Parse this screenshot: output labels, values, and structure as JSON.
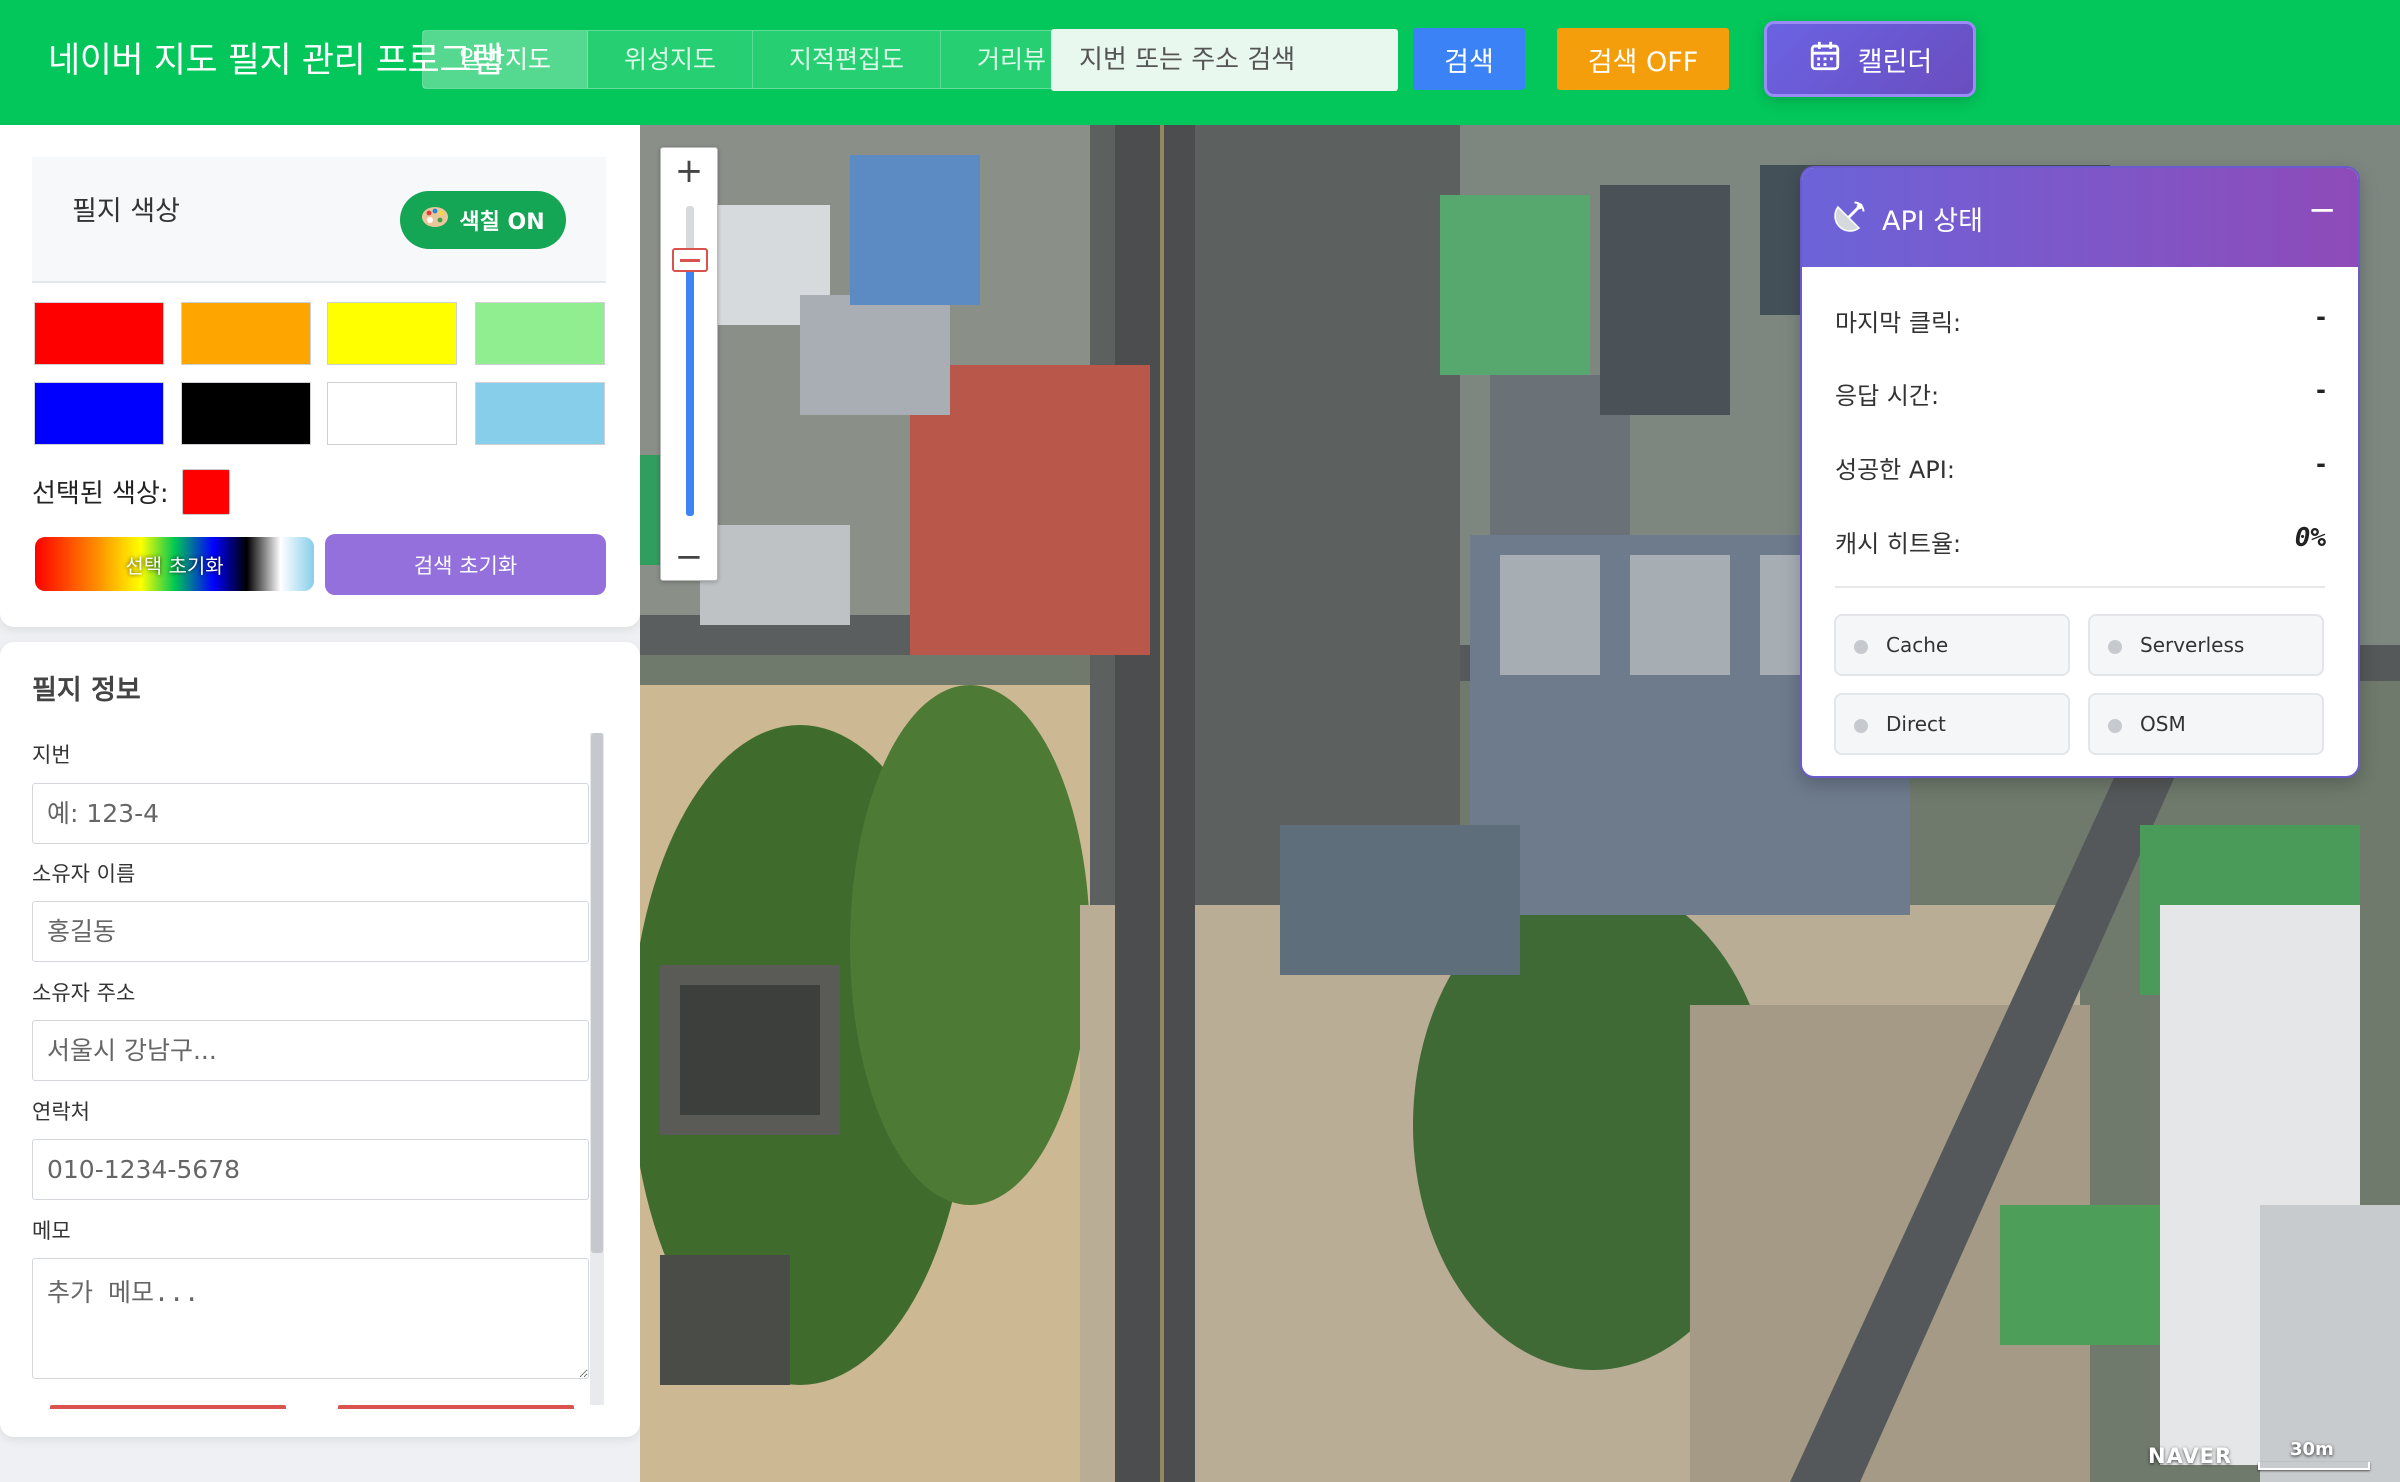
{
  "header": {
    "app_title": "네이버 지도 필지 관리 프로그램",
    "map_types": [
      "일반지도",
      "위성지도",
      "지적편집도",
      "거리뷰"
    ],
    "search_placeholder": "지번 또는 주소 검색",
    "search_label": "검색",
    "search_toggle_label": "검색 OFF",
    "calendar_label": "캘린더",
    "calendar_icon": "calendar-icon"
  },
  "color_panel": {
    "title": "필지 색상",
    "fill_toggle_label": "색칠 ON",
    "fill_toggle_icon": "palette-icon",
    "swatches": [
      "#ff0000",
      "#ffa500",
      "#ffff00",
      "#90ee90",
      "#0000ff",
      "#000000",
      "#ffffff",
      "#87ceeb"
    ],
    "selected_label": "선택된 색상:",
    "selected_color": "#ff0000",
    "reset_selection_label": "선택 초기화",
    "reset_search_label": "검색 초기화"
  },
  "parcel_info": {
    "title": "필지 정보",
    "fields": [
      {
        "label": "지번",
        "placeholder": "예: 123-4"
      },
      {
        "label": "소유자 이름",
        "placeholder": "홍길동"
      },
      {
        "label": "소유자 주소",
        "placeholder": "서울시 강남구..."
      },
      {
        "label": "연락처",
        "placeholder": "010-1234-5678"
      }
    ],
    "memo_label": "메모",
    "memo_placeholder": "추가 메모..."
  },
  "map": {
    "zoom_in": "+",
    "zoom_out": "−",
    "zoom_level_fraction": 0.82,
    "brand": "NAVER",
    "scale_label": "30m"
  },
  "api_status": {
    "title": "API 상태",
    "icon": "satellite-dish-icon",
    "minimize": "−",
    "rows": [
      {
        "label": "마지막 클릭:",
        "value": "-"
      },
      {
        "label": "응답 시간:",
        "value": "-"
      },
      {
        "label": "성공한 API:",
        "value": "-"
      },
      {
        "label": "캐시 히트율:",
        "value": "0%"
      }
    ],
    "chips": [
      "Cache",
      "Serverless",
      "Direct",
      "OSM"
    ]
  },
  "colors": {
    "header_green": "#03c75a",
    "search_blue": "#3b82f6",
    "search_off_orange": "#f59e0b",
    "calendar_purple": "#6b63e3",
    "fill_on_green": "#14a555",
    "reset_search_purple": "#9370db"
  }
}
